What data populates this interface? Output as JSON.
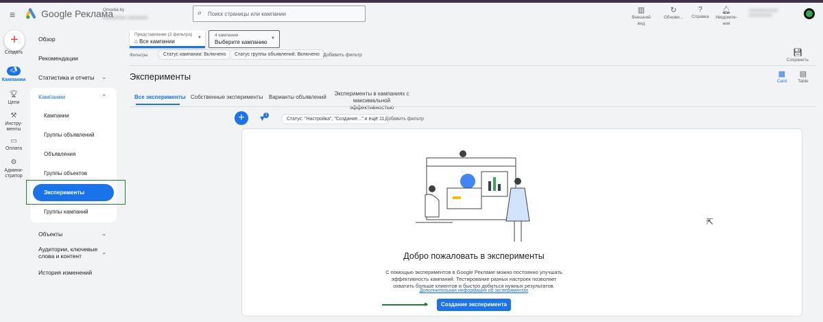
{
  "app": {
    "title": "Google Реклама",
    "account_name": "Qmedia.by",
    "search_placeholder": "Поиск страницы или кампании"
  },
  "toolbar": [
    {
      "label": "Внешний вид",
      "icon": "appearance-icon"
    },
    {
      "label": "Обнови...",
      "icon": "refresh-icon"
    },
    {
      "label": "Справка",
      "icon": "help-icon"
    },
    {
      "label": "Уведомле-ния",
      "icon": "bell-icon"
    }
  ],
  "rail": {
    "create": "Создать",
    "items": [
      {
        "label": "Кампании"
      },
      {
        "label": "Цели"
      },
      {
        "label": "Инстру-менты"
      },
      {
        "label": "Оплата"
      },
      {
        "label": "Админи-стратор"
      }
    ]
  },
  "sidebar": {
    "overview": "Обзор",
    "recommendations": "Рекомендации",
    "stats": "Статистика и отчеты",
    "campaigns": "Кампании",
    "sub": [
      "Кампании",
      "Группы объявлений",
      "Объявления",
      "Группы объектов",
      "Эксперименты",
      "Группы кампаний"
    ],
    "objects": "Объекты",
    "audiences": "Аудитории, ключевые слова и контент",
    "history": "История изменений"
  },
  "view": {
    "label": "Представление (2 фильтра)",
    "value": "Все кампании"
  },
  "campaign_select": {
    "label": "4 кампании",
    "value": "Выберите кампанию"
  },
  "filters": {
    "label": "Фильтры",
    "chips": [
      "Статус кампании: Включено",
      "Статус группы объявлений: Включено"
    ],
    "add": "Добавить фильтр"
  },
  "save": "Сохранить",
  "page_title": "Эксперименты",
  "views": {
    "card": "Card",
    "table": "Table"
  },
  "tabs": [
    "Все эксперименты",
    "Собственные эксперименты",
    "Варианты объявлений",
    "Эксперименты в кампаниях с максимальной эффективностью"
  ],
  "exp_filter": {
    "badge": "1",
    "chip": "Статус: \"Настройка\", \"Создание...\" и ещё 11",
    "add": "Добавить фильтр"
  },
  "empty": {
    "title": "Добро пожаловать в эксперименты",
    "text": "С помощью экспериментов в Google Рекламе можно постоянно улучшать эффективность кампаний. Тестирование разных настроек позволяет охватить больше клиентов и быстро добиться нужных результатов.",
    "link": "Дополнительная информация об экспериментах",
    "button": "Создание эксперимента"
  },
  "colors": {
    "accent": "#1a73e8",
    "highlight": "#1e7e34"
  }
}
